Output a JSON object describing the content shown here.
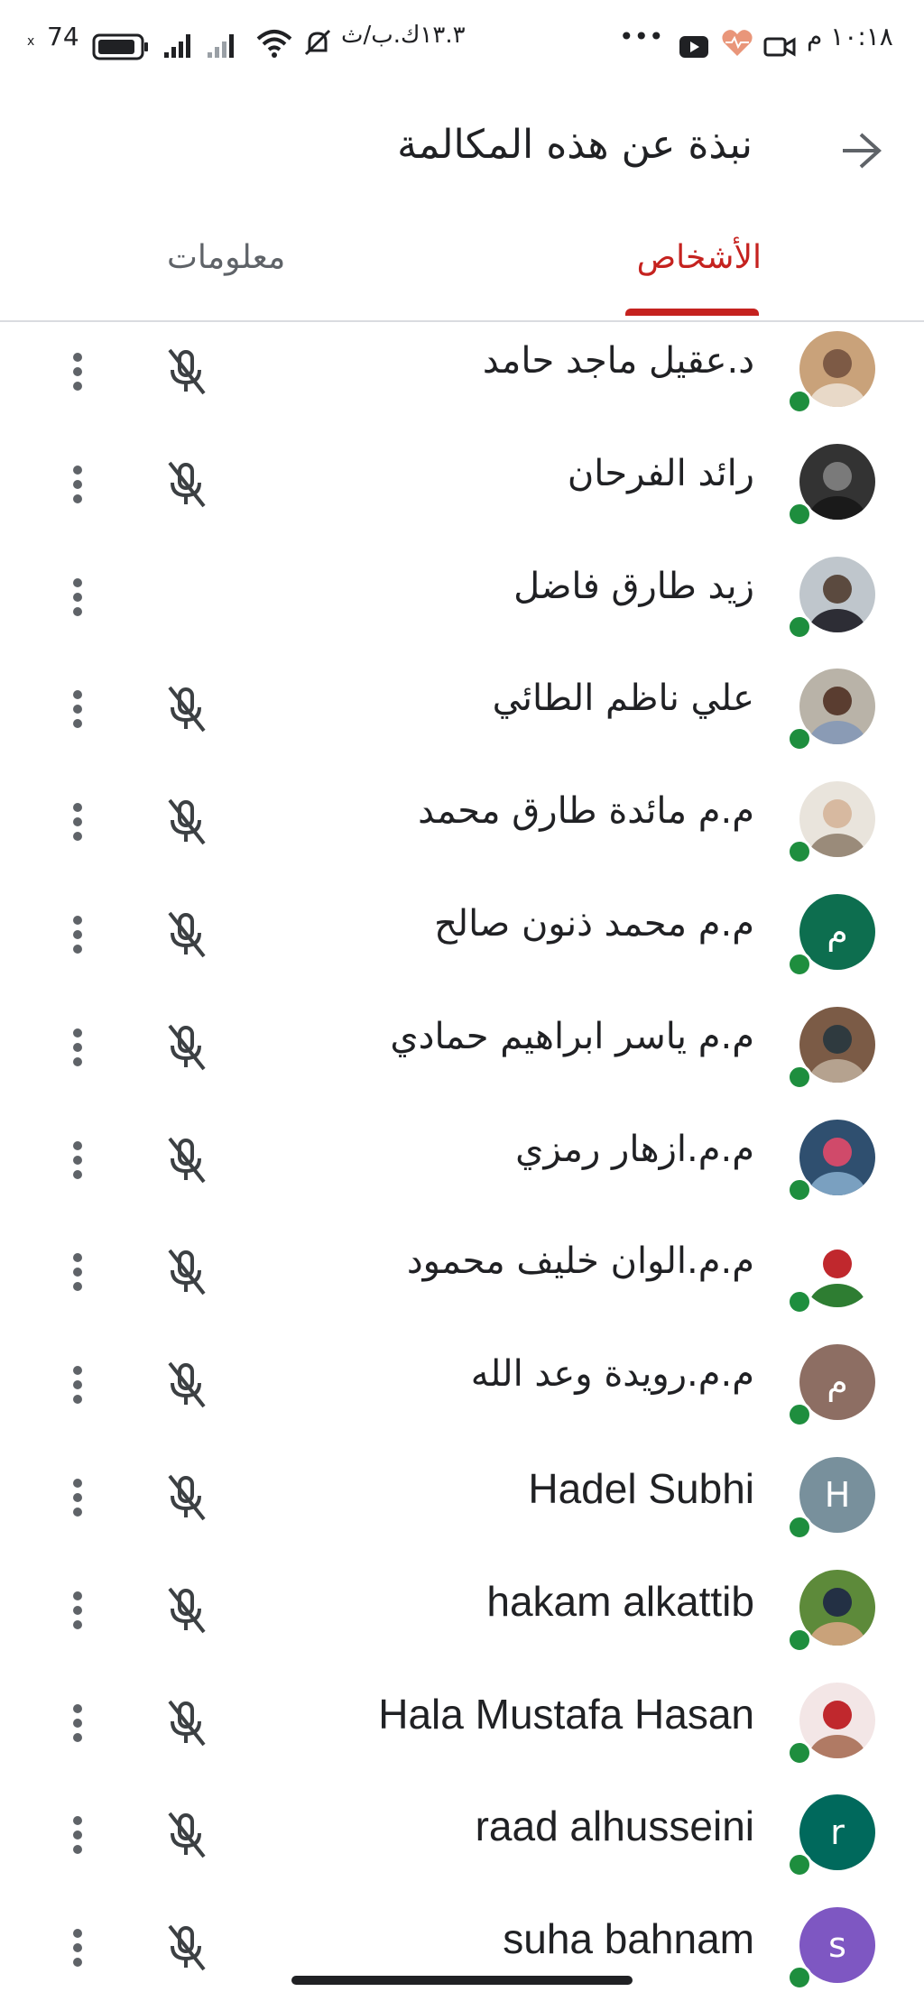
{
  "status_bar": {
    "time": "١٠:١٨ م",
    "speed": "١٣.٣ك.ب/ث",
    "battery": "74",
    "battery_suffix": "x",
    "more": "•••"
  },
  "header": {
    "title": "نبذة عن هذه المكالمة"
  },
  "tabs": [
    {
      "label": "الأشخاص",
      "active": true
    },
    {
      "label": "معلومات",
      "active": false
    }
  ],
  "colors": {
    "accent": "#c5221f",
    "presence": "#1e8e3e",
    "icon": "#5f6368"
  },
  "participants": [
    {
      "name": "د.عقيل ماجد حامد",
      "avatar": "photo",
      "photo_colors": [
        "#c9a27a",
        "#7d5a45",
        "#e8d9c8"
      ],
      "muted": true
    },
    {
      "name": "رائد الفرحان",
      "avatar": "photo",
      "photo_colors": [
        "#333333",
        "#7a7a7a",
        "#1a1a1a"
      ],
      "muted": true
    },
    {
      "name": "زيد طارق فاضل",
      "avatar": "photo",
      "photo_colors": [
        "#bfc6cc",
        "#5b4a3f",
        "#2d2d35"
      ],
      "muted": false
    },
    {
      "name": "علي ناظم الطائي",
      "avatar": "photo",
      "photo_colors": [
        "#b9b3a8",
        "#5a3d30",
        "#8a9bb5"
      ],
      "muted": true
    },
    {
      "name": "م.م مائدة طارق محمد",
      "avatar": "photo",
      "photo_colors": [
        "#e9e4dc",
        "#d7b9a0",
        "#9a8b7a"
      ],
      "muted": true
    },
    {
      "name": "م.م محمد ذنون صالح",
      "avatar": "letter",
      "letter": "م",
      "bg": "#0d6e4f",
      "muted": true
    },
    {
      "name": "م.م ياسر ابراهيم حمادي",
      "avatar": "photo",
      "photo_colors": [
        "#7b5b46",
        "#2f3a3f",
        "#b5a28f"
      ],
      "muted": true
    },
    {
      "name": "م.م.ازهار رمزي",
      "avatar": "photo",
      "photo_colors": [
        "#2f4f6f",
        "#d04a6a",
        "#7aa0c0"
      ],
      "muted": true
    },
    {
      "name": "م.م.الوان خليف محمود",
      "avatar": "photo",
      "photo_colors": [
        "#ffffff",
        "#c0282d",
        "#2e7d32"
      ],
      "muted": true
    },
    {
      "name": "م.م.رويدة وعد الله",
      "avatar": "letter",
      "letter": "م",
      "bg": "#8d6e63",
      "muted": true
    },
    {
      "name": "Hadel Subhi",
      "avatar": "letter",
      "letter": "H",
      "bg": "#78909c",
      "muted": true,
      "latin": true
    },
    {
      "name": "hakam alkattib",
      "avatar": "photo",
      "photo_colors": [
        "#5d8a3a",
        "#233044",
        "#c9a27a"
      ],
      "muted": true,
      "latin": true
    },
    {
      "name": "Hala Mustafa Hasan",
      "avatar": "photo",
      "photo_colors": [
        "#f3e6e6",
        "#c0282d",
        "#b07a64"
      ],
      "muted": true,
      "latin": true
    },
    {
      "name": "raad alhusseini",
      "avatar": "letter",
      "letter": "r",
      "bg": "#00695c",
      "muted": true,
      "latin": true
    },
    {
      "name": "suha bahnam",
      "avatar": "letter",
      "letter": "s",
      "bg": "#7e57c2",
      "muted": true,
      "latin": true
    }
  ]
}
